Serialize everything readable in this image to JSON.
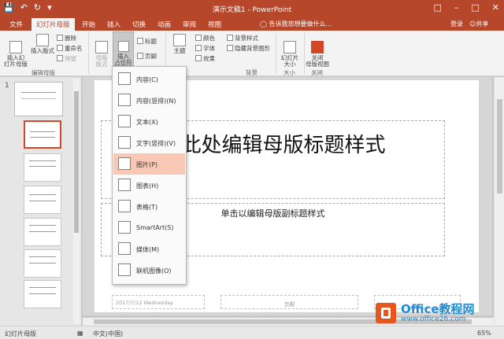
{
  "app": {
    "title": "演示文稿1 - PowerPoint"
  },
  "qat": {
    "save_icon": "save-icon",
    "undo_icon": "undo-icon",
    "redo_icon": "redo-icon"
  },
  "tabs": [
    "文件",
    "幻灯片母版",
    "开始",
    "插入",
    "切换",
    "动画",
    "审阅",
    "视图"
  ],
  "tellme": "告诉我您想要做什么...",
  "account": {
    "login": "登录",
    "share": "共享"
  },
  "ribbon": {
    "insert_master": "插入幻\n灯片母版",
    "insert_layout": "插入版式",
    "delete": "删除",
    "rename": "重命名",
    "preserve": "保留",
    "master_layout": "母版\n版式",
    "insert_placeholder": "插入\n占位符",
    "title_check": "标题",
    "footer_check": "页脚",
    "theme": "主题",
    "colors": "颜色",
    "fonts": "字体",
    "effects": "效果",
    "bg_styles": "背景样式",
    "hide_bg": "隐藏背景图形",
    "slide_size": "幻灯片\n大小",
    "close_master": "关闭\n母版视图",
    "groups": {
      "edit_master": "编辑母版",
      "background": "背景",
      "size": "大小",
      "close": "关闭"
    }
  },
  "dropdown": {
    "items": [
      {
        "label": "内容(C)"
      },
      {
        "label": "内容(竖排)(N)"
      },
      {
        "label": "文本(X)"
      },
      {
        "label": "文字(竖排)(V)"
      },
      {
        "label": "图片(P)"
      },
      {
        "label": "图表(H)"
      },
      {
        "label": "表格(T)"
      },
      {
        "label": "SmartArt(S)"
      },
      {
        "label": "媒体(M)"
      },
      {
        "label": "联机图像(O)"
      }
    ],
    "highlighted": "图片(P)"
  },
  "slide": {
    "title": "击此处编辑母版标题样式",
    "subtitle": "单击以编辑母版副标题样式",
    "footer_date": "2017/7/12 Wednesday",
    "footer_center": "页脚"
  },
  "thumbnails": {
    "slide_number": "1"
  },
  "status": {
    "view": "幻灯片母版",
    "language": "中文(中国)",
    "zoom": "65%"
  },
  "watermark": {
    "line1": "Office教程网",
    "line2": "www.office26.com"
  },
  "colors": {
    "accent": "#b7472a",
    "highlight": "#f8c8b4"
  }
}
